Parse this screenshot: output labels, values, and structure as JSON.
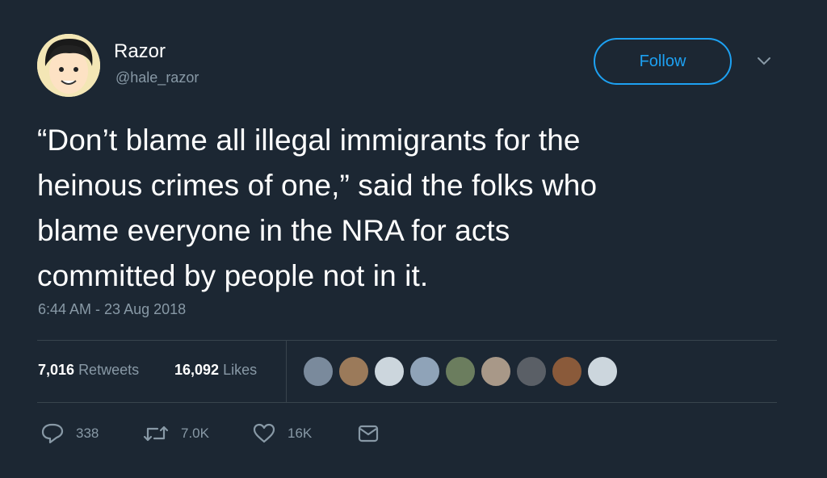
{
  "user": {
    "name": "Razor",
    "handle": "@hale_razor",
    "follow_label": "Follow"
  },
  "tweet": {
    "lines": [
      "“Don’t blame all illegal immigrants for the",
      "heinous crimes of one,” said the folks who",
      "blame everyone in the NRA for acts",
      "committed by people not in it."
    ],
    "timestamp": "6:44 AM - 23 Aug 2018"
  },
  "stats": {
    "retweets_count": "7,016",
    "retweets_label": "Retweets",
    "likes_count": "16,092",
    "likes_label": "Likes"
  },
  "actions": {
    "reply_count": "338",
    "retweet_count": "7.0K",
    "like_count": "16K"
  },
  "colors": {
    "background": "#1c2733",
    "accent": "#1da1f2",
    "muted": "#8899a6",
    "divider": "#38444d"
  },
  "icons": [
    "chevron-down-icon",
    "reply-icon",
    "retweet-icon",
    "heart-icon",
    "message-icon"
  ]
}
